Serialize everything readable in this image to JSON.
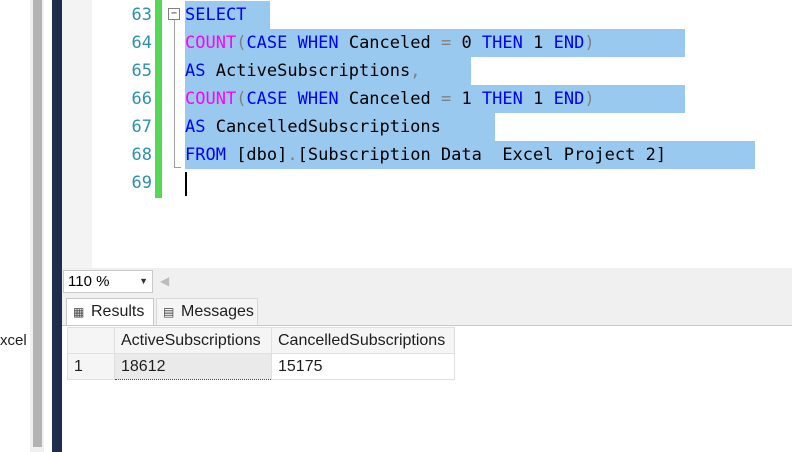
{
  "left_panel": {
    "partial_text": "xcel"
  },
  "editor": {
    "lines": [
      {
        "number": "63",
        "tokens": [
          {
            "t": "SELECT",
            "c": "kw"
          }
        ]
      },
      {
        "number": "64",
        "tokens": [
          {
            "t": "COUNT",
            "c": "fn"
          },
          {
            "t": "(",
            "c": "op"
          },
          {
            "t": "CASE",
            "c": "kw"
          },
          {
            "t": " ",
            "c": "id"
          },
          {
            "t": "WHEN",
            "c": "kw"
          },
          {
            "t": " Canceled ",
            "c": "id"
          },
          {
            "t": "=",
            "c": "op"
          },
          {
            "t": " 0 ",
            "c": "id"
          },
          {
            "t": "THEN",
            "c": "kw"
          },
          {
            "t": " 1 ",
            "c": "id"
          },
          {
            "t": "END",
            "c": "kw"
          },
          {
            "t": ")",
            "c": "op"
          }
        ]
      },
      {
        "number": "65",
        "tokens": [
          {
            "t": "AS",
            "c": "kw"
          },
          {
            "t": " ActiveSubscriptions",
            "c": "id"
          },
          {
            "t": ",",
            "c": "op"
          }
        ]
      },
      {
        "number": "66",
        "tokens": [
          {
            "t": "COUNT",
            "c": "fn"
          },
          {
            "t": "(",
            "c": "op"
          },
          {
            "t": "CASE",
            "c": "kw"
          },
          {
            "t": " ",
            "c": "id"
          },
          {
            "t": "WHEN",
            "c": "kw"
          },
          {
            "t": " Canceled ",
            "c": "id"
          },
          {
            "t": "=",
            "c": "op"
          },
          {
            "t": " 1 ",
            "c": "id"
          },
          {
            "t": "THEN",
            "c": "kw"
          },
          {
            "t": " 1 ",
            "c": "id"
          },
          {
            "t": "END",
            "c": "kw"
          },
          {
            "t": ")",
            "c": "op"
          }
        ]
      },
      {
        "number": "67",
        "tokens": [
          {
            "t": "AS",
            "c": "kw"
          },
          {
            "t": " CancelledSubscriptions",
            "c": "id"
          }
        ]
      },
      {
        "number": "68",
        "tokens": [
          {
            "t": "FROM",
            "c": "kw"
          },
          {
            "t": " [dbo]",
            "c": "id"
          },
          {
            "t": ".",
            "c": "op"
          },
          {
            "t": "[Subscription Data  Excel Project 2]",
            "c": "id"
          }
        ]
      },
      {
        "number": "69",
        "tokens": []
      }
    ]
  },
  "zoom": {
    "value": "110 %"
  },
  "tabs": {
    "results": "Results",
    "messages": "Messages"
  },
  "grid": {
    "columns": [
      "ActiveSubscriptions",
      "CancelledSubscriptions"
    ],
    "rows": [
      {
        "num": "1",
        "cells": [
          "18612",
          "15175"
        ]
      }
    ]
  },
  "colors": {
    "keyword": "#0000ff",
    "function": "#ff00ff",
    "operator": "#808080",
    "line_number": "#2b91af",
    "selection": "#99c9ef",
    "change_bar": "#57d757"
  }
}
